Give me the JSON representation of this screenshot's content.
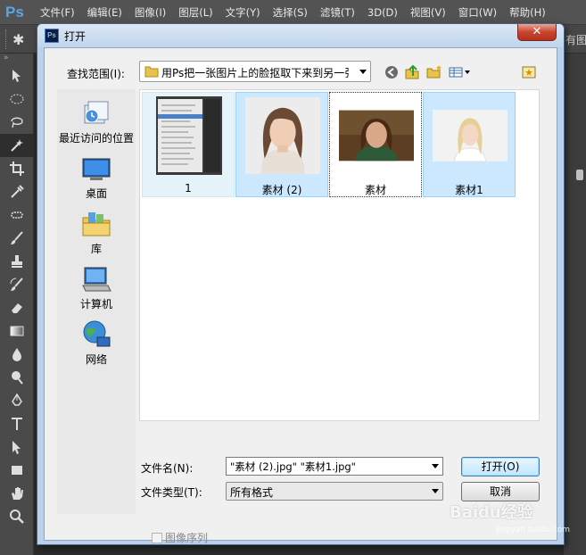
{
  "app": {
    "logo": "Ps",
    "menu": [
      "文件(F)",
      "编辑(E)",
      "图像(I)",
      "图层(L)",
      "文字(Y)",
      "选择(S)",
      "滤镜(T)",
      "3D(D)",
      "视图(V)",
      "窗口(W)",
      "帮助(H)"
    ],
    "right_panel_text": "有图"
  },
  "toolbar": {
    "tools": [
      "move-tool",
      "marquee-tool",
      "lasso-tool",
      "magic-wand-tool",
      "crop-tool",
      "eyedropper-tool",
      "healing-brush-tool",
      "brush-tool",
      "stamp-tool",
      "history-brush-tool",
      "eraser-tool",
      "gradient-tool",
      "blur-tool",
      "dodge-tool",
      "pen-tool",
      "type-tool",
      "path-selection-tool",
      "rectangle-tool",
      "hand-tool",
      "zoom-tool"
    ],
    "active_tool": "magic-wand-tool"
  },
  "dialog": {
    "title": "打开",
    "icon_text": "Ps",
    "close_label": "✕",
    "look_in_label": "查找范围(I):",
    "look_in_value": "用Ps把一张图片上的脸抠取下来到另一张",
    "places": [
      {
        "label": "最近访问的位置",
        "icon": "recent-places-icon"
      },
      {
        "label": "桌面",
        "icon": "desktop-icon"
      },
      {
        "label": "库",
        "icon": "libraries-icon"
      },
      {
        "label": "计算机",
        "icon": "computer-icon"
      },
      {
        "label": "网络",
        "icon": "network-icon"
      }
    ],
    "files": [
      {
        "name": "1",
        "state": "light"
      },
      {
        "name": "素材 (2)",
        "state": "selected"
      },
      {
        "name": "素材",
        "state": "focus"
      },
      {
        "name": "素材1",
        "state": "selected"
      }
    ],
    "filename_label": "文件名(N):",
    "filename_value": "\"素材 (2).jpg\" \"素材1.jpg\"",
    "filetype_label": "文件类型(T):",
    "filetype_value": "所有格式",
    "open_button": "打开(O)",
    "cancel_button": "取消",
    "image_sequence_label": "图像序列"
  },
  "watermark": {
    "text": "Baidu经验",
    "sub": "jingyan.baidu.com"
  },
  "colors": {
    "ps_blue": "#5ba4e6",
    "selection": "#cce8ff",
    "dialog_frame": "#b9d1ea"
  }
}
